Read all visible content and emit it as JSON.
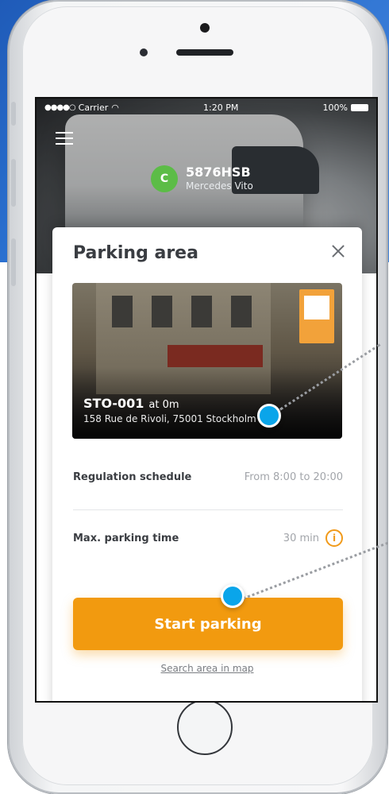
{
  "status_bar": {
    "carrier": "Carrier",
    "time": "1:20 PM",
    "battery": "100%"
  },
  "vehicle": {
    "badge": "C",
    "plate": "5876HSB",
    "model": "Mercedes Vito"
  },
  "card": {
    "title": "Parking area",
    "zone_code": "STO-001",
    "distance": "at 0m",
    "address": "158 Rue de Rivoli, 75001 Stockholm",
    "rows": [
      {
        "label": "Regulation schedule",
        "value": "From 8:00 to 20:00"
      },
      {
        "label": "Max. parking time",
        "value": "30 min"
      }
    ],
    "info_icon": "i",
    "start_button": "Start parking",
    "map_link": "Search area in map"
  },
  "colors": {
    "accent": "#f29a0f",
    "badge_green": "#5cbc47",
    "marker_blue": "#0aa5ea"
  }
}
